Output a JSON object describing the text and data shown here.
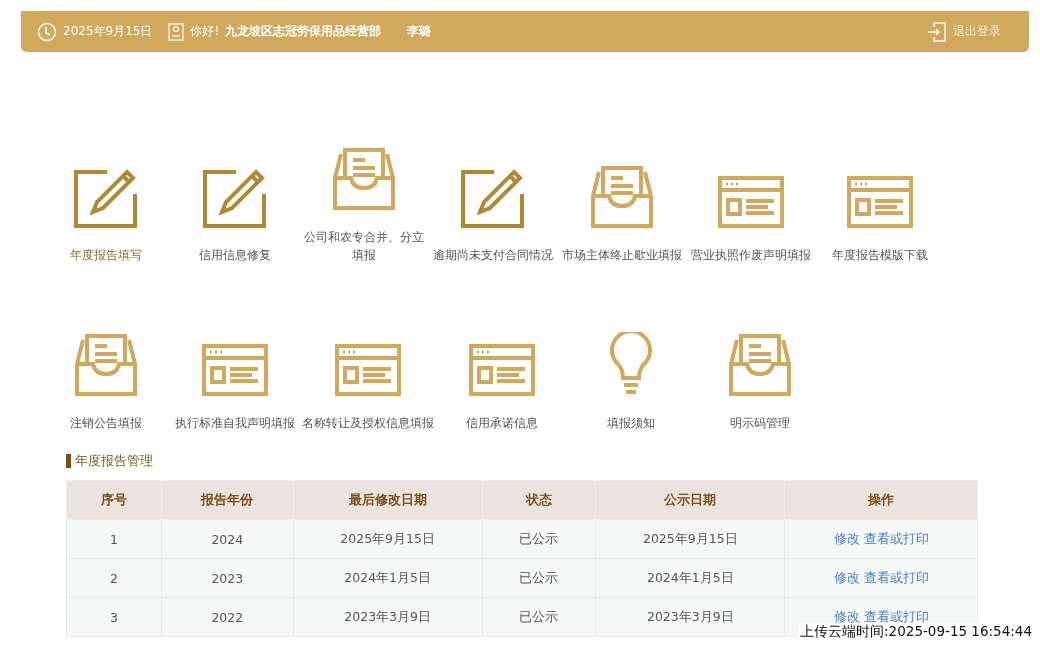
{
  "header": {
    "date": "2025年9月15日",
    "greeting": "你好!",
    "company": "九龙坡区志冠劳保用品经营部",
    "user": "李璐",
    "logout": "退出登录"
  },
  "menu_rows": [
    [
      {
        "label": "年度报告填写",
        "kind": "edit",
        "selected": true
      },
      {
        "label": "信用信息修复",
        "kind": "edit",
        "selected": false
      },
      {
        "label": "公司和农专合并、分立填报",
        "kind": "inbox",
        "selected": false
      },
      {
        "label": "逾期尚未支付合同情况",
        "kind": "edit",
        "selected": false
      },
      {
        "label": "市场主体终止歇业填报",
        "kind": "inbox",
        "selected": false
      },
      {
        "label": "营业执照作废声明填报",
        "kind": "window",
        "selected": false
      },
      {
        "label": "年度报告模版下载",
        "kind": "window",
        "selected": false
      }
    ],
    [
      {
        "label": "注销公告填报",
        "kind": "inbox",
        "selected": false
      },
      {
        "label": "执行标准自我声明填报",
        "kind": "window",
        "selected": false
      },
      {
        "label": "名称转让及授权信息填报",
        "kind": "window",
        "selected": false
      },
      {
        "label": "信用承诺信息",
        "kind": "window",
        "selected": false
      },
      {
        "label": "填报须知",
        "kind": "bulb",
        "selected": false
      },
      {
        "label": "明示码管理",
        "kind": "inbox",
        "selected": false
      }
    ]
  ],
  "section_title": "年度报告管理",
  "table": {
    "columns": [
      "序号",
      "报告年份",
      "最后修改日期",
      "状态",
      "公示日期",
      "操作"
    ],
    "rows": [
      {
        "no": "1",
        "year": "2024",
        "modified": "2025年9月15日",
        "status": "已公示",
        "published": "2025年9月15日",
        "actions": [
          "修改",
          "查看或打印"
        ]
      },
      {
        "no": "2",
        "year": "2023",
        "modified": "2024年1月5日",
        "status": "已公示",
        "published": "2024年1月5日",
        "actions": [
          "修改",
          "查看或打印"
        ]
      },
      {
        "no": "3",
        "year": "2022",
        "modified": "2023年3月9日",
        "status": "已公示",
        "published": "2023年3月9日",
        "actions": [
          "修改",
          "查看或打印"
        ]
      }
    ]
  },
  "upload_time": "上传云端时间:2025-09-15 16:54:44"
}
